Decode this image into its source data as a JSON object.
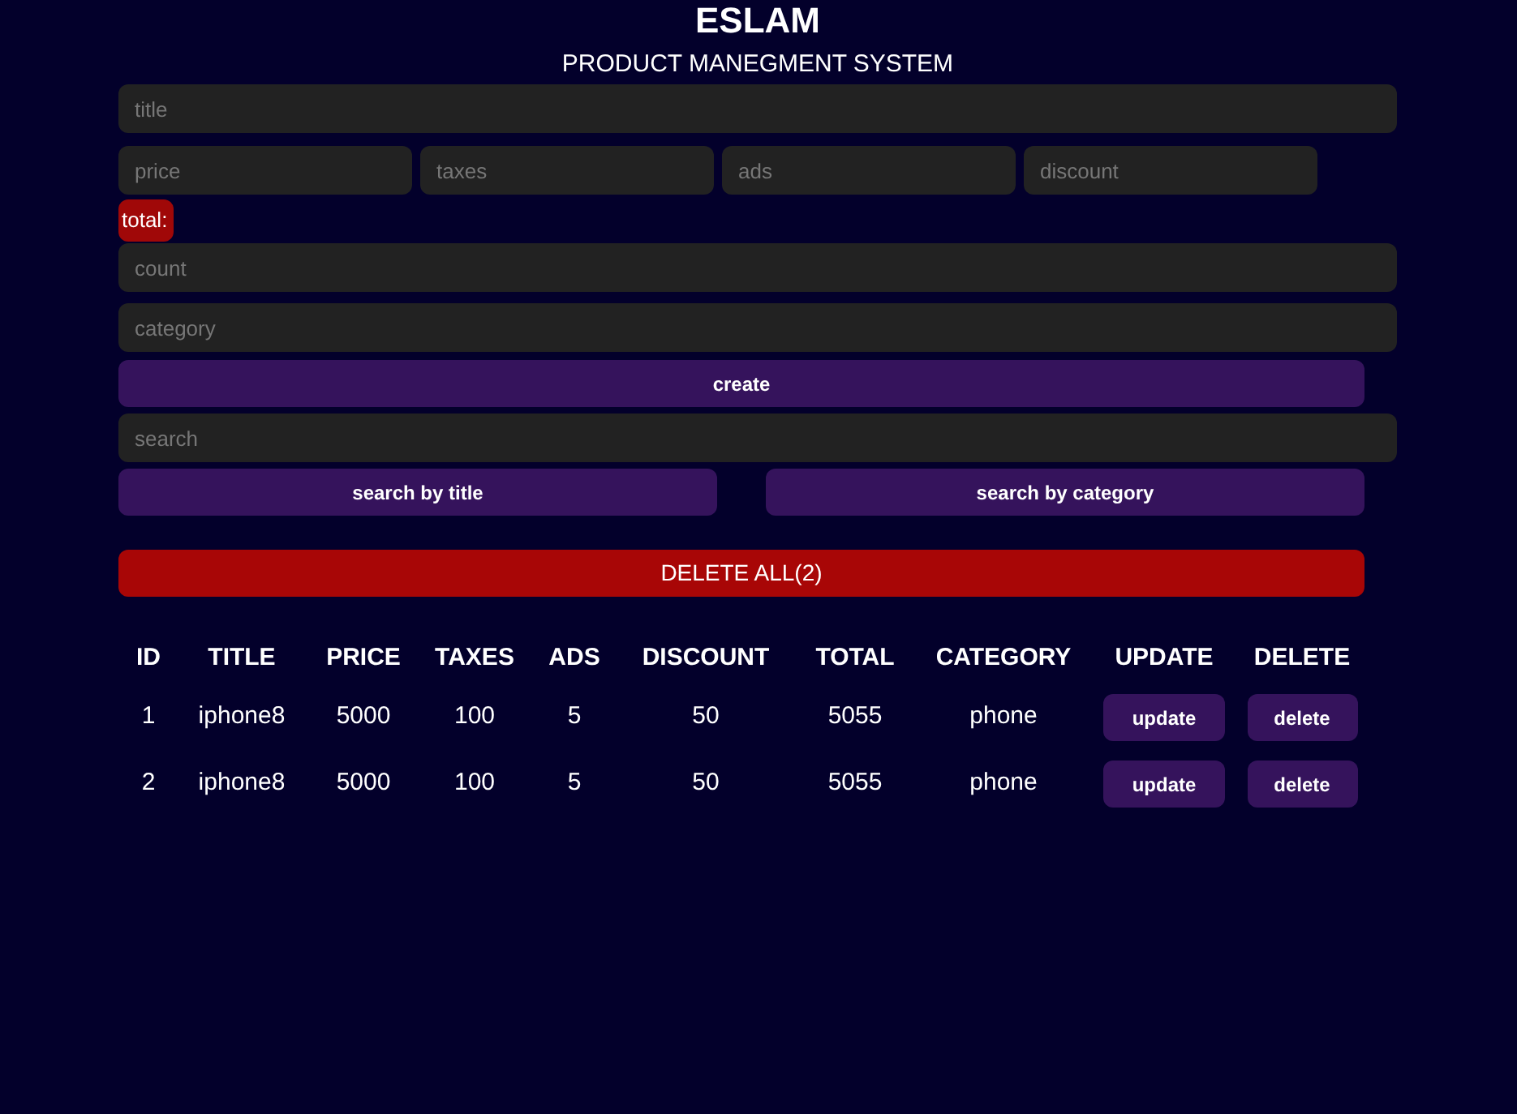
{
  "header": {
    "title": "ESLAM",
    "subtitle": "PRODUCT MANEGMENT SYSTEM"
  },
  "form": {
    "title": {
      "placeholder": "title"
    },
    "prices": [
      {
        "placeholder": "price"
      },
      {
        "placeholder": "taxes"
      },
      {
        "placeholder": "ads"
      },
      {
        "placeholder": "discount"
      }
    ],
    "total": {
      "label": "total:"
    },
    "count": {
      "placeholder": "count"
    },
    "category": {
      "placeholder": "category"
    },
    "create_button": "create"
  },
  "search": {
    "placeholder": "search",
    "buttons": [
      "search by title",
      "search by category"
    ]
  },
  "delete_all_button": "DELETE ALL(2)",
  "table": {
    "columns": [
      "ID",
      "TITLE",
      "PRICE",
      "TAXES",
      "ADS",
      "DISCOUNT",
      "TOTAL",
      "CATEGORY",
      "UPDATE",
      "DELETE"
    ],
    "rows": [
      {
        "cells": [
          "1",
          "iphone8",
          "5000",
          "100",
          "5",
          "50",
          "5055",
          "phone"
        ],
        "update": "update",
        "delete": "delete"
      },
      {
        "cells": [
          "2",
          "iphone8",
          "5000",
          "100",
          "5",
          "50",
          "5055",
          "phone"
        ],
        "update": "update",
        "delete": "delete"
      }
    ]
  }
}
